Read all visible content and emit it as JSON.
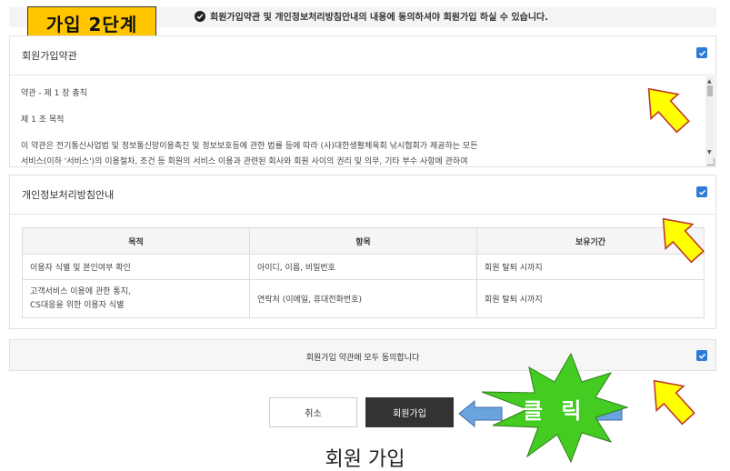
{
  "step_label": "가입 2단계",
  "notice": "회원가입약관 및 개인정보처리방침안내의 내용에 동의하셔야 회원가입 하실 수 있습니다.",
  "terms": {
    "title": "회원가입약관",
    "lines": [
      "약관 - 제 1 장 총칙",
      "제 1 조 목적",
      "이 약관은 전기통신사업법 및 정보통신망이용촉진 및 정보보호등에 관한 법률 등에 따라 (사)대한생활체육회 낚시협회가 제공하는 모든",
      "서비스(이하 '서비스')의 이용절차, 조건 등 회원의 서비스 이용과 관련된 회사와 회원 사이의 권리 및 의무, 기타 부수 사항에 관하여"
    ]
  },
  "privacy": {
    "title": "개인정보처리방침안내",
    "headers": [
      "목적",
      "항목",
      "보유기간"
    ],
    "rows": [
      [
        "이용자 식별 및 본인여부 확인",
        "아이디, 이름, 비밀번호",
        "회원 탈퇴 시까지"
      ],
      [
        "고객서비스 이용에 관한 통지,\nCS대응을 위한 이용자 식별",
        "연락처 (이메일, 휴대전화번호)",
        "회원 탈퇴 시까지"
      ]
    ]
  },
  "agree_all": "회원가입 약관에 모두 동의합니다",
  "buttons": {
    "cancel": "취소",
    "join": "회원가입"
  },
  "callout": "클 릭",
  "page_title": "회원 가입",
  "colors": {
    "accent": "#2e7bd6",
    "highlight": "#ffc600",
    "arrow": "#ffff00",
    "burst": "#44cc22",
    "dark_button": "#333333"
  }
}
